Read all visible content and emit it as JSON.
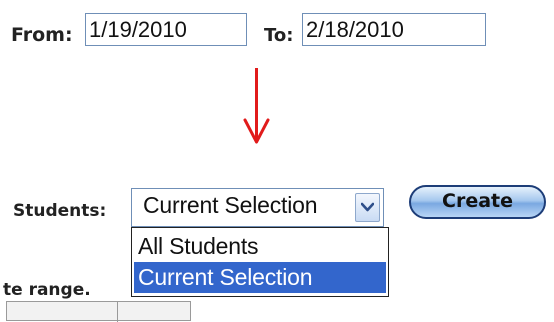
{
  "date_range": {
    "from_label": "From:",
    "from_value": "1/19/2010",
    "to_label": "To:",
    "to_value": "2/18/2010"
  },
  "annotation": {
    "arrow_color": "#e11b1b",
    "arrow_direction": "down"
  },
  "students": {
    "label": "Students:",
    "selected_value": "Current Selection",
    "options": [
      "All Students",
      "Current Selection"
    ],
    "highlighted_option": "Current Selection",
    "highlight_color": "#3366cc"
  },
  "create_button": {
    "label": "Create"
  },
  "partial_text": "te range."
}
